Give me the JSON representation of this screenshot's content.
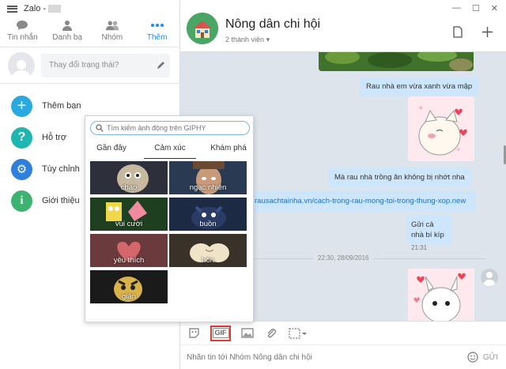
{
  "app": {
    "title": "Zalo -"
  },
  "nav_tabs": [
    {
      "label": "Tin nhắn",
      "icon": "chat-icon"
    },
    {
      "label": "Danh bạ",
      "icon": "contact-icon"
    },
    {
      "label": "Nhóm",
      "icon": "group-icon"
    },
    {
      "label": "Thêm",
      "icon": "more-icon",
      "active": true
    }
  ],
  "status": {
    "placeholder": "Thay đổi trạng thái?"
  },
  "menu": [
    {
      "label": "Thêm bạn",
      "glyph": "+",
      "color": "#29a9df"
    },
    {
      "label": "Hỗ trợ",
      "glyph": "?",
      "color": "#1fb5b0"
    },
    {
      "label": "Tùy chỉnh",
      "glyph": "⚙",
      "color": "#2f7fdc"
    },
    {
      "label": "Giới thiệu",
      "glyph": "i",
      "color": "#3cb371"
    }
  ],
  "chat": {
    "title": "Nông dân chi hội",
    "subtitle": "2 thành viên",
    "messages": [
      {
        "text": "Rau nhà em vừa xanh vừa mập"
      },
      {
        "text": "Mà rau nhà trồng ăn không bị nhớt nha"
      },
      {
        "text": "rausachtainha.vn/cach-trong-rau-mong-toi-trong-thung-xop.new"
      },
      {
        "text": "Gửi cả nhà bí kíp",
        "time": "21:31"
      }
    ],
    "date_divider": "22:30, 28/09/2016"
  },
  "gif_picker": {
    "search_placeholder": "Tìm kiếm ảnh động trên GIPHY",
    "tabs": [
      "Gần đây",
      "Cảm xúc",
      "Khám phá"
    ],
    "active_tab": "Cảm xúc",
    "tiles": [
      "chào",
      "ngạc nhiên",
      "vui cười",
      "buồn",
      "yêu thích",
      "hôn",
      "giận"
    ]
  },
  "toolbar": {
    "gif_label": "GIF"
  },
  "composer": {
    "placeholder": "Nhắn tin tới Nhóm Nông dân chi hội",
    "send_label": "GỬI"
  },
  "colors": {
    "accent": "#1a8cff",
    "bubble": "#cde6fb",
    "chat_bg": "#dde4ec",
    "highlight": "#e53935"
  }
}
